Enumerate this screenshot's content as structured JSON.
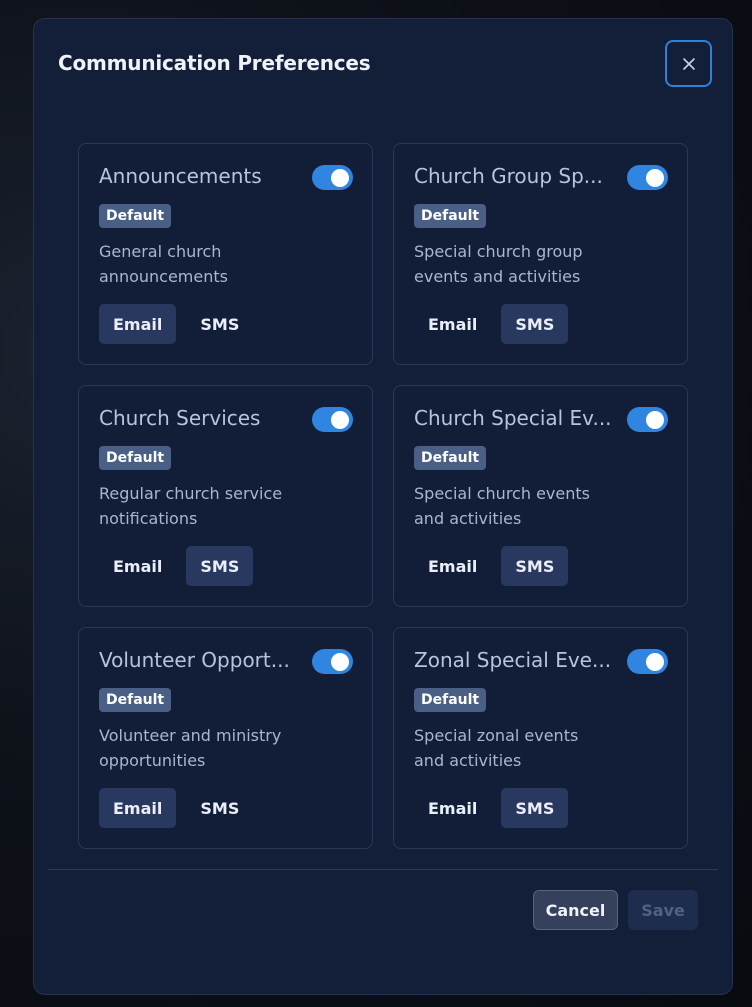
{
  "dialog": {
    "title": "Communication Preferences",
    "close_icon": "close-icon"
  },
  "accent_color": "#2f85df",
  "preferences": [
    {
      "title": "Announcements",
      "enabled": true,
      "badge": "Default",
      "description": "General church announcements",
      "channels": [
        {
          "label": "Email",
          "selected": true
        },
        {
          "label": "SMS",
          "selected": false
        }
      ]
    },
    {
      "title": "Church Group Sp...",
      "enabled": true,
      "badge": "Default",
      "description": "Special church group events and activities",
      "channels": [
        {
          "label": "Email",
          "selected": false
        },
        {
          "label": "SMS",
          "selected": true
        }
      ]
    },
    {
      "title": "Church Services",
      "enabled": true,
      "badge": "Default",
      "description": "Regular church service notifications",
      "channels": [
        {
          "label": "Email",
          "selected": false
        },
        {
          "label": "SMS",
          "selected": true
        }
      ]
    },
    {
      "title": "Church Special Ev...",
      "enabled": true,
      "badge": "Default",
      "description": "Special church events and activities",
      "channels": [
        {
          "label": "Email",
          "selected": false
        },
        {
          "label": "SMS",
          "selected": true
        }
      ]
    },
    {
      "title": "Volunteer Opport...",
      "enabled": true,
      "badge": "Default",
      "description": "Volunteer and ministry opportunities",
      "channels": [
        {
          "label": "Email",
          "selected": true
        },
        {
          "label": "SMS",
          "selected": false
        }
      ]
    },
    {
      "title": "Zonal Special Eve...",
      "enabled": true,
      "badge": "Default",
      "description": "Special zonal events and activities",
      "channels": [
        {
          "label": "Email",
          "selected": false
        },
        {
          "label": "SMS",
          "selected": true
        }
      ]
    }
  ],
  "footer": {
    "cancel_label": "Cancel",
    "save_label": "Save",
    "save_disabled": true
  }
}
